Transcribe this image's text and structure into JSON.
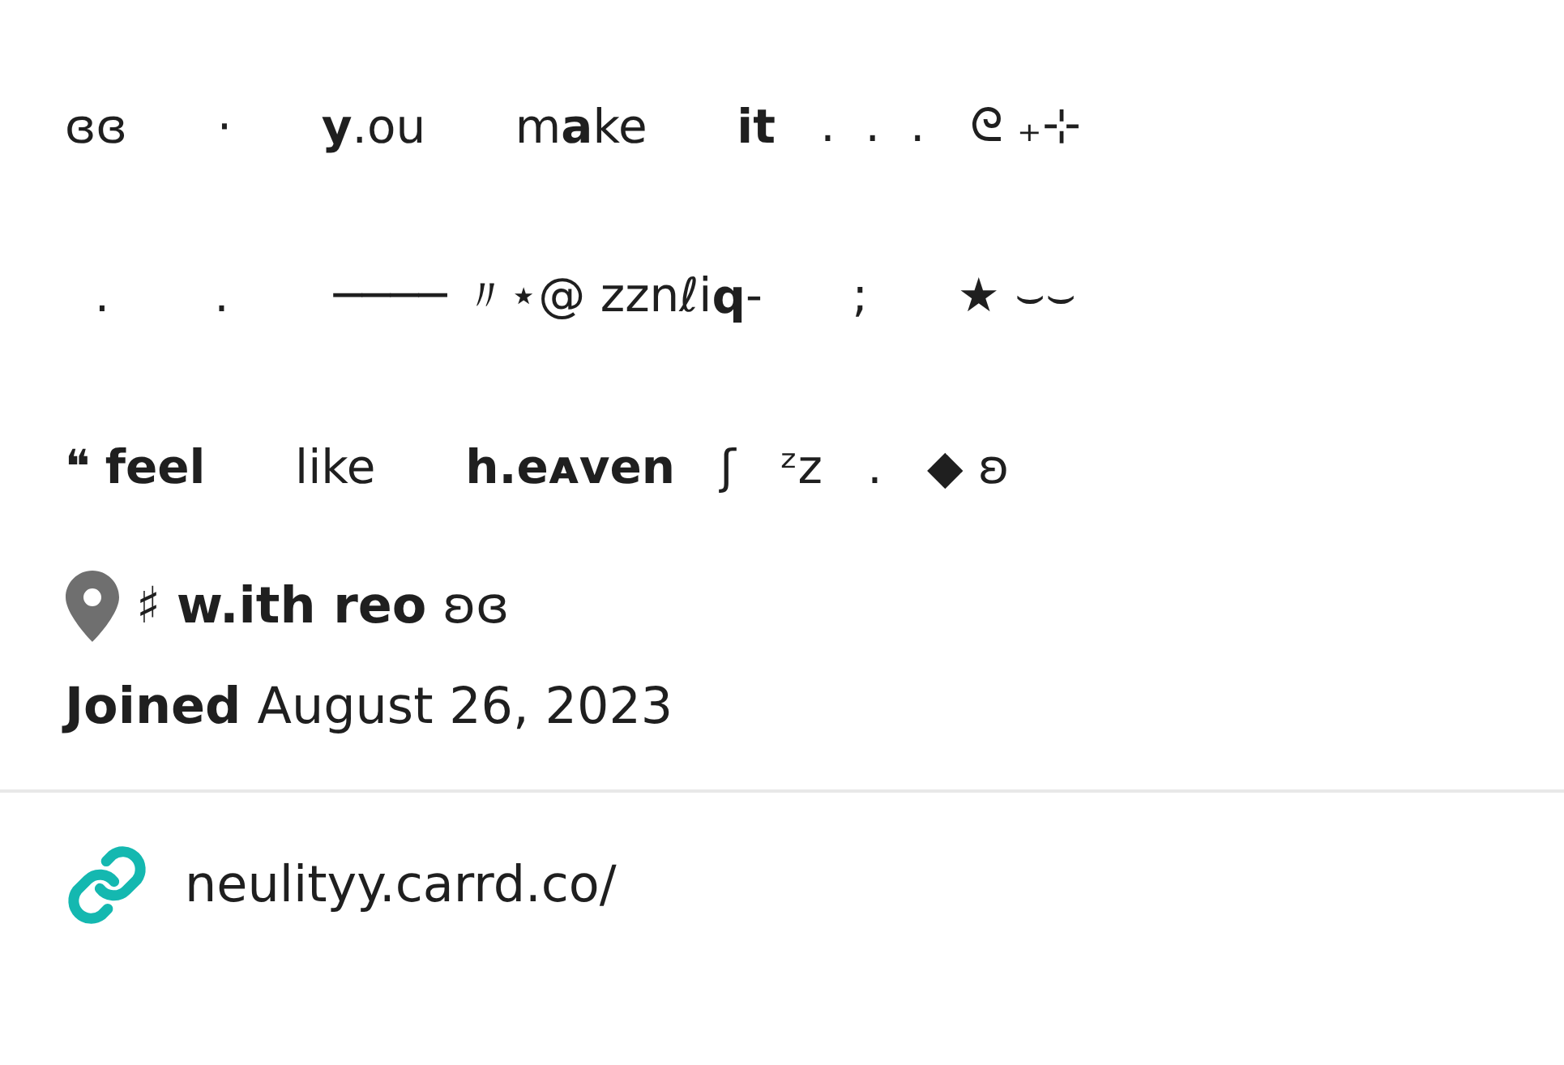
{
  "bio": {
    "lines": [
      "ɞɞ      ·      **y**.ou      m**a**ke      **it**   .  .  .   ᘓ ₊⊹",
      "  .       .       ──── 〃⋆@ zznℓi**q**-      ;      ★ ⌣⌣",
      "❝ **feel**      like      **h.eᴀven**   ʃ   ᶻz   .   ◆ ʚ"
    ]
  },
  "location": "♯ **w.ith reo** ʚɞ",
  "joined": {
    "label": "Joined",
    "date": "August 26, 2023"
  },
  "link": {
    "url": "neulityy.carrd.co/"
  }
}
